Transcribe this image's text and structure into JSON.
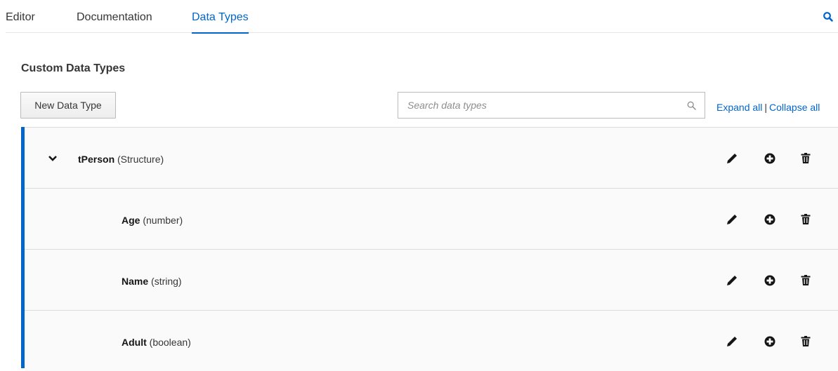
{
  "tabs": [
    {
      "label": "Editor",
      "active": false
    },
    {
      "label": "Documentation",
      "active": false
    },
    {
      "label": "Data Types",
      "active": true
    }
  ],
  "heading": "Custom Data Types",
  "toolbar": {
    "new_button": "New Data Type",
    "search_placeholder": "Search data types",
    "expand_all": "Expand all",
    "separator": "|",
    "collapse_all": "Collapse all"
  },
  "data_types": [
    {
      "name": "tPerson",
      "type": "(Structure)",
      "level": 0,
      "expanded": true
    },
    {
      "name": "Age",
      "type": "(number)",
      "level": 1
    },
    {
      "name": "Name",
      "type": "(string)",
      "level": 1
    },
    {
      "name": "Adult",
      "type": "(boolean)",
      "level": 1
    }
  ],
  "row_actions": [
    "pencil-icon",
    "plus-circle-icon",
    "trash-icon"
  ],
  "colors": {
    "accent": "#0066cc",
    "text": "#151515",
    "border": "#dcdcdc"
  }
}
